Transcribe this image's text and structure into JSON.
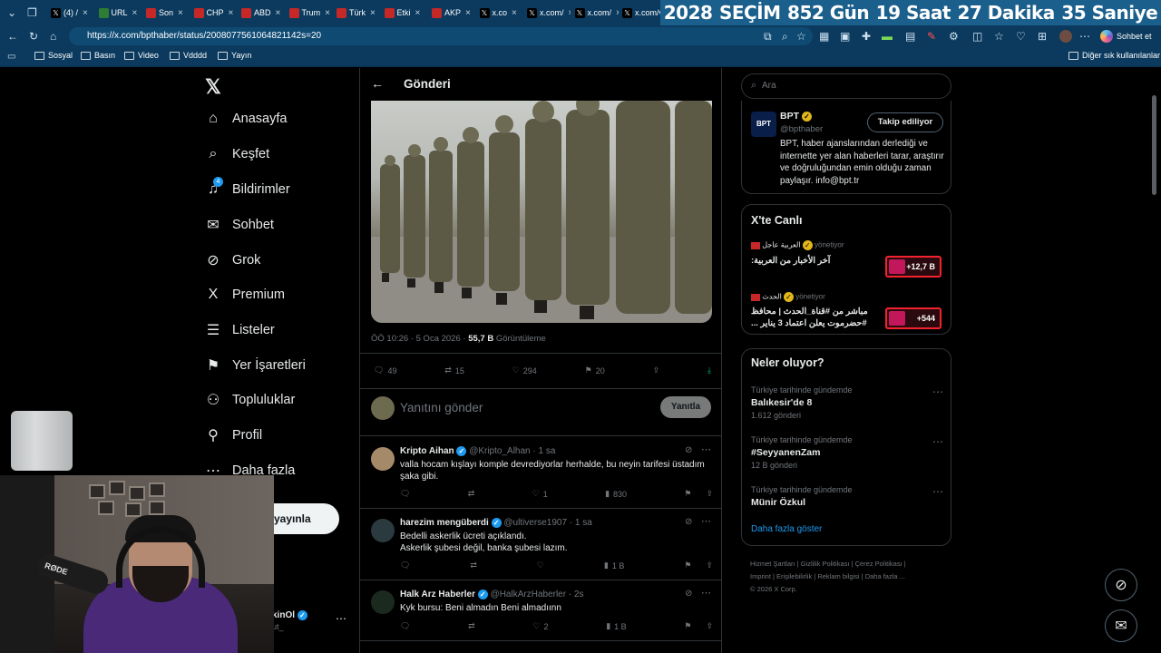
{
  "browser": {
    "tabs": [
      {
        "label": "(4) /",
        "fav": "x"
      },
      {
        "label": "URL",
        "fav": "g"
      },
      {
        "label": "Son",
        "fav": "r"
      },
      {
        "label": "CHP",
        "fav": "r"
      },
      {
        "label": "ABD",
        "fav": "r"
      },
      {
        "label": "Trum",
        "fav": "r"
      },
      {
        "label": "Türk",
        "fav": "r"
      },
      {
        "label": "Etki",
        "fav": "r"
      },
      {
        "label": "AKP",
        "fav": "r"
      },
      {
        "label": "x.co",
        "fav": "x"
      },
      {
        "label": "x.com/",
        "fav": "x"
      },
      {
        "label": "x.com/",
        "fav": "x"
      },
      {
        "label": "x.com/v",
        "fav": "x"
      }
    ],
    "countdown": [
      "2028",
      "SEÇİM",
      "852 Gün",
      "19 Saat",
      "27 Dakika",
      "35 Saniye"
    ],
    "url": "https://x.com/bpthaber/status/2008077561064821142s=20",
    "chat_button": "Sohbet et",
    "bookmarks": [
      "Sosyal",
      "Basın",
      "Video",
      "Vdddd",
      "Yayın"
    ],
    "other_bookmarks": "Diğer sık kullanılanlar"
  },
  "nav": {
    "items": [
      {
        "label": "Anasayfa",
        "icon": "home-icon",
        "glyph": "⌂"
      },
      {
        "label": "Keşfet",
        "icon": "search-icon",
        "glyph": "⌕"
      },
      {
        "label": "Bildirimler",
        "icon": "bell-icon",
        "glyph": "♫",
        "badge": "4"
      },
      {
        "label": "Sohbet",
        "icon": "mail-icon",
        "glyph": "✉"
      },
      {
        "label": "Grok",
        "icon": "grok-icon",
        "glyph": "⊘"
      },
      {
        "label": "Premium",
        "icon": "x-logo-icon",
        "glyph": "X"
      },
      {
        "label": "Listeler",
        "icon": "list-icon",
        "glyph": "☰"
      },
      {
        "label": "Yer İşaretleri",
        "icon": "bookmark-icon",
        "glyph": "⚑"
      },
      {
        "label": "Topluluklar",
        "icon": "communities-icon",
        "glyph": "⚇"
      },
      {
        "label": "Profil",
        "icon": "profile-icon",
        "glyph": "⚲"
      },
      {
        "label": "Daha fazla",
        "icon": "more-icon",
        "glyph": "⋯"
      }
    ],
    "post_button": "yayınla",
    "account_name": "kinOl",
    "account_handle": "ut_"
  },
  "post": {
    "header": "Gönderi",
    "timestamp": "ÖÖ 10:26 · 5 Oca 2026 ·",
    "views_count": "55,7 B",
    "views_label": "Görüntüleme",
    "stats": {
      "replies": "49",
      "reposts": "15",
      "likes": "294",
      "bookmarks": "20"
    },
    "reply_placeholder": "Yanıtını gönder",
    "reply_button": "Yanıtla"
  },
  "replies": [
    {
      "name": "Kripto Aihan",
      "handle": "@Kripto_Alhan · 1 sa",
      "text": "valla hocam kışlayı komple devrediyorlar herhalde, bu neyin tarifesi üstadım şaka gibi.",
      "likes": "1",
      "views": "830"
    },
    {
      "name": "harezim mengüberdi",
      "handle": "@ultiverse1907 · 1 sa",
      "text": "Bedelli askerlik ücreti açıklandı.\nAskerlik şubesi değil, banka şubesi lazım.",
      "likes": "",
      "views": "1 B"
    },
    {
      "name": "Halk Arz Haberler",
      "handle": "@HalkArzHaberler · 2s",
      "text": "Kyk bursu: Beni almadın Beni almadıınn",
      "likes": "2",
      "views": "1 B"
    }
  ],
  "right": {
    "search_placeholder": "Ara",
    "profile": {
      "name": "BPT",
      "handle": "@bpthaber",
      "follow_button": "Takip ediliyor",
      "bio": "BPT, haber ajanslarından derlediği ve internette yer alan haberleri tarar, araştırır ve doğruluğundan emin olduğu zaman paylaşır. info@bpt.tr"
    },
    "live": {
      "title": "X'te Canlı",
      "items": [
        {
          "source": "العربية عاجل",
          "role": "yönetiyor",
          "text": "آخر الأخبار من العربية:",
          "count": "+12,7 B"
        },
        {
          "source": "الحدث",
          "role": "yönetiyor",
          "text": "مباشر من #قناة_الحدث | محافظ #حضرموت يعلن اعتماد 3 يناير ...",
          "count": "+544"
        }
      ]
    },
    "trends": {
      "title": "Neler oluyor?",
      "items": [
        {
          "meta": "Türkiye tarihinde gündemde",
          "name": "Balıkesir'de 8",
          "count": "1.612 gönderi"
        },
        {
          "meta": "Türkiye tarihinde gündemde",
          "name": "#SeyyanenZam",
          "count": "12 B gönderi"
        },
        {
          "meta": "Türkiye tarihinde gündemde",
          "name": "Münir Özkul",
          "count": ""
        }
      ],
      "show_more": "Daha fazla göster"
    },
    "footer": {
      "line1": "Hizmet Şartları  |  Gizlilik Politikası  |  Çerez Politikası  |",
      "line2": "Imprint  |  Erişilebilirlik  |  Reklam bilgisi  |  Daha fazla ...",
      "line3": "© 2026 X Corp."
    }
  },
  "colors": {
    "accent": "#1d9bf0",
    "browser_bg": "#0b3a5e",
    "countdown_bg": "#1b5f8c",
    "live_red": "#f4212e"
  }
}
